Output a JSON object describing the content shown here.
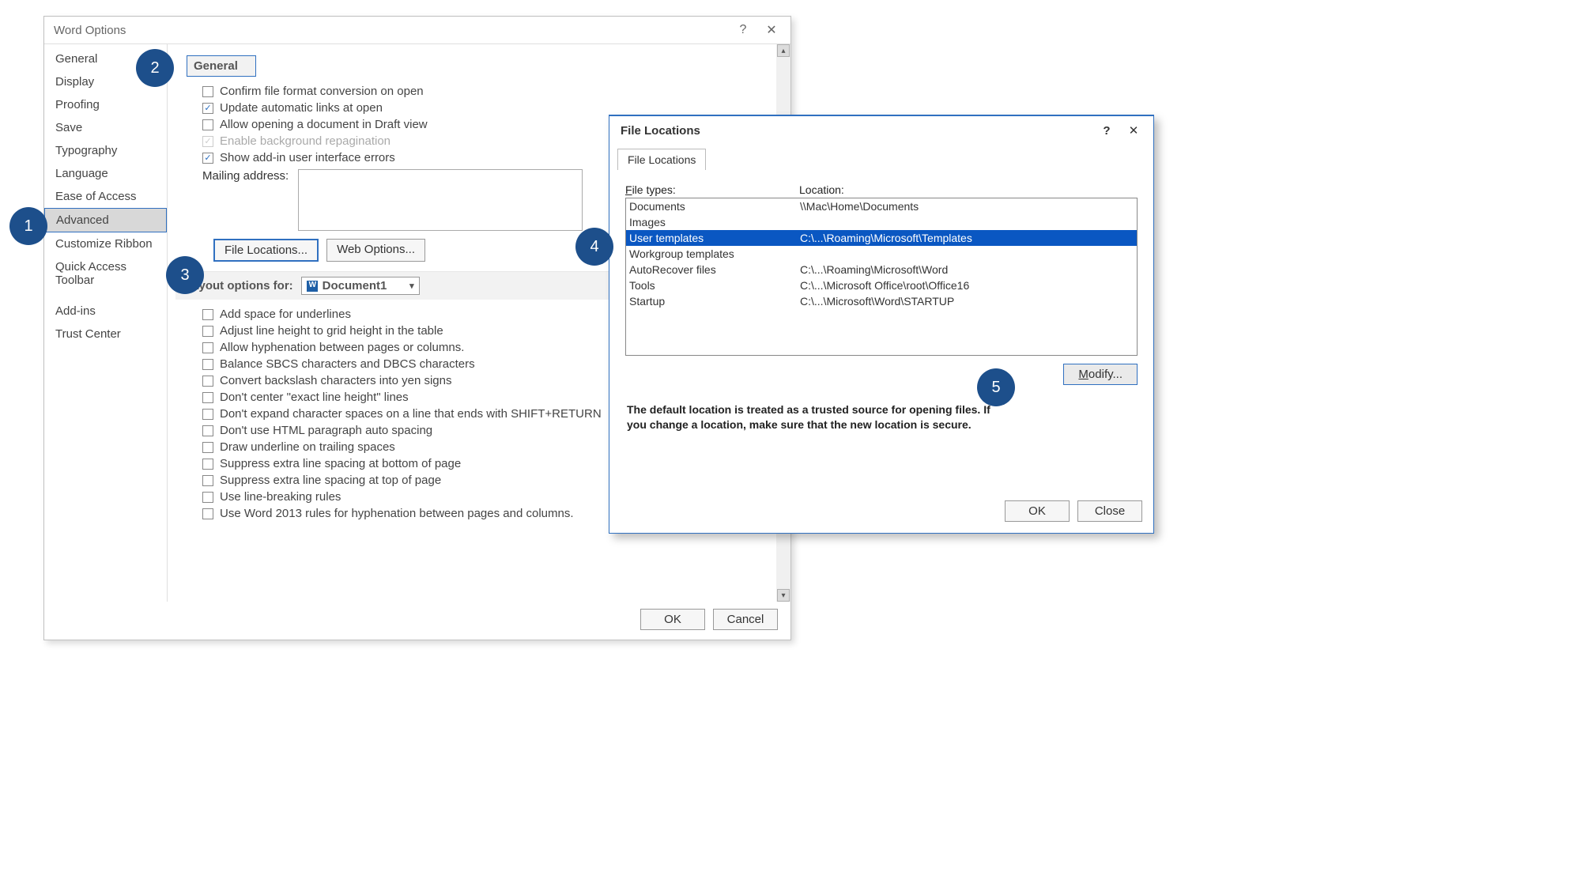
{
  "wordOptions": {
    "title": "Word Options",
    "sidebar": [
      "General",
      "Display",
      "Proofing",
      "Save",
      "Typography",
      "Language",
      "Ease of Access",
      "Advanced",
      "Customize Ribbon",
      "Quick Access Toolbar",
      "Add-ins",
      "Trust Center"
    ],
    "selectedSidebarIndex": 7,
    "generalSection": {
      "header": "General",
      "confirmFileFormat": {
        "label": "Confirm file format conversion on open",
        "checked": false
      },
      "updateAutoLinks": {
        "label": "Update automatic links at open",
        "checked": true
      },
      "allowDraft": {
        "label": "Allow opening a document in Draft view",
        "checked": false
      },
      "enableBackground": {
        "label": "Enable background repagination",
        "checked": true,
        "disabled": true
      },
      "showAddin": {
        "label": "Show add-in user interface errors",
        "checked": true
      },
      "mailingLabel": "Mailing address:",
      "fileLocationsBtn": "File Locations...",
      "webOptionsBtn": "Web Options..."
    },
    "layoutSection": {
      "header": "Layout options for:",
      "document": "Document1",
      "options": [
        "Add space for underlines",
        "Adjust line height to grid height in the table",
        "Allow hyphenation between pages or columns.",
        "Balance SBCS characters and DBCS characters",
        "Convert backslash characters into yen signs",
        "Don't center \"exact line height\" lines",
        "Don't expand character spaces on a line that ends with SHIFT+RETURN",
        "Don't use HTML paragraph auto spacing",
        "Draw underline on trailing spaces",
        "Suppress extra line spacing at bottom of page",
        "Suppress extra line spacing at top of page",
        "Use line-breaking rules",
        "Use Word 2013 rules for hyphenation between pages and columns."
      ]
    },
    "ok": "OK",
    "cancel": "Cancel"
  },
  "fileLocations": {
    "title": "File Locations",
    "tab": "File Locations",
    "colFileTypes": "File types:",
    "colLocation": "Location:",
    "rows": [
      {
        "type": "Documents",
        "loc": "\\\\Mac\\Home\\Documents"
      },
      {
        "type": "Images",
        "loc": ""
      },
      {
        "type": "User templates",
        "loc": "C:\\...\\Roaming\\Microsoft\\Templates"
      },
      {
        "type": "Workgroup templates",
        "loc": ""
      },
      {
        "type": "AutoRecover files",
        "loc": "C:\\...\\Roaming\\Microsoft\\Word"
      },
      {
        "type": "Tools",
        "loc": "C:\\...\\Microsoft Office\\root\\Office16"
      },
      {
        "type": "Startup",
        "loc": "C:\\...\\Microsoft\\Word\\STARTUP"
      }
    ],
    "selectedRowIndex": 2,
    "modify": "Modify...",
    "note": "The default location is treated as a trusted source for opening files. If you change a location, make sure that the new location is secure.",
    "ok": "OK",
    "close": "Close"
  },
  "badges": [
    "1",
    "2",
    "3",
    "4",
    "5"
  ]
}
